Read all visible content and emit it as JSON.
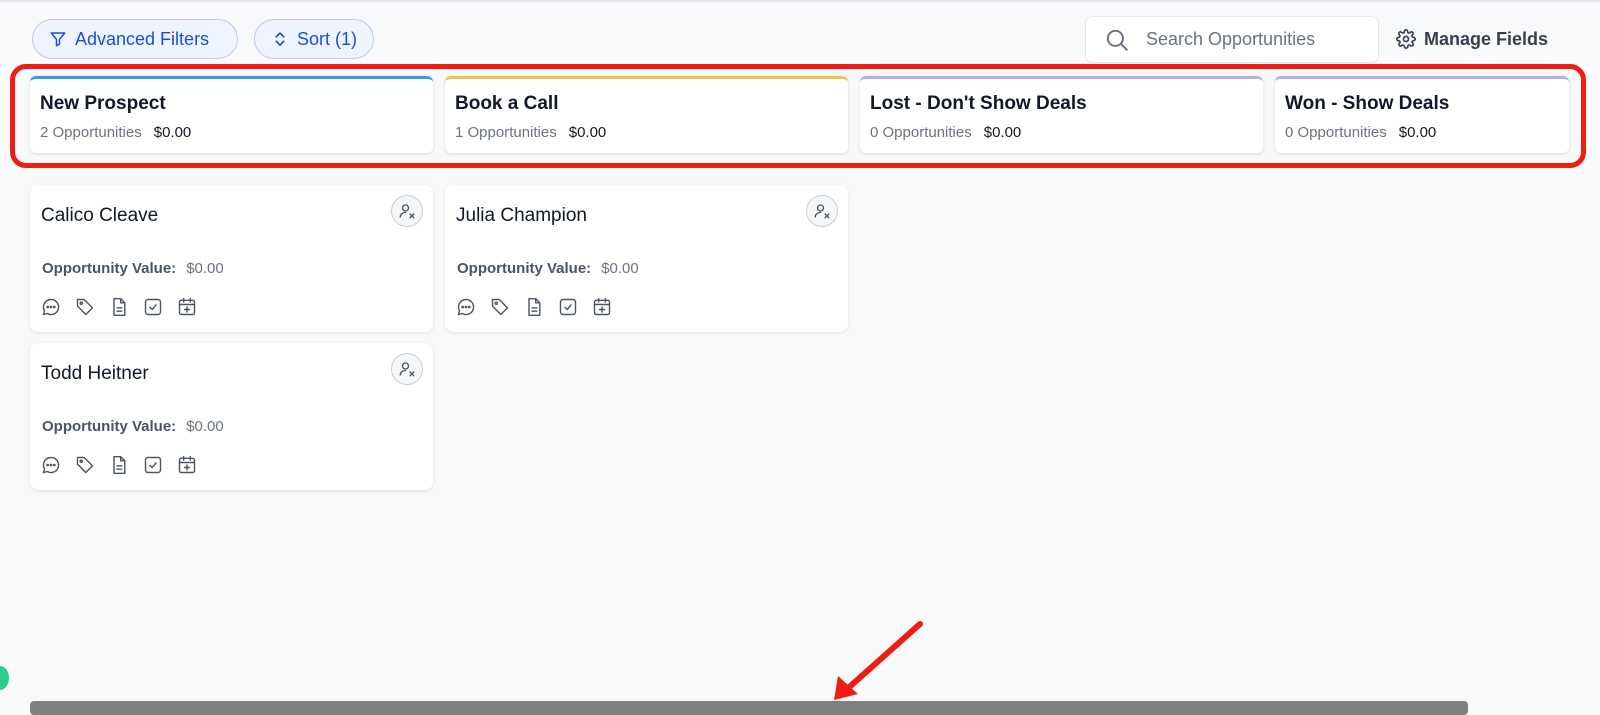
{
  "toolbar": {
    "filters_label": "Advanced Filters",
    "sort_label": "Sort (1)",
    "search_placeholder": "Search Opportunities",
    "manage_fields_label": "Manage Fields",
    "accent_color": "#1d4ed8"
  },
  "stages": [
    {
      "title": "New Prospect",
      "count": "2 Opportunities",
      "value": "$0.00",
      "color": "#3b9be0"
    },
    {
      "title": "Book a Call",
      "count": "1 Opportunities",
      "value": "$0.00",
      "color": "#f2c14b"
    },
    {
      "title": "Lost - Don't Show Deals",
      "count": "0 Opportunities",
      "value": "$0.00",
      "color": "#aab4e6"
    },
    {
      "title": "Won - Show Deals",
      "count": "0 Opportunities",
      "value": "$0.00",
      "color": "#aab4e6"
    }
  ],
  "cards": [
    {
      "name": "Calico Cleave",
      "value_label": "Opportunity Value:",
      "value": "$0.00",
      "stage": "New Prospect"
    },
    {
      "name": "Todd Heitner",
      "value_label": "Opportunity Value:",
      "value": "$0.00",
      "stage": "New Prospect"
    },
    {
      "name": "Julia Champion",
      "value_label": "Opportunity Value:",
      "value": "$0.00",
      "stage": "Book a Call"
    }
  ],
  "card_action_icons": [
    "chat-icon",
    "tag-icon",
    "note-icon",
    "task-icon",
    "calendar-add-icon"
  ],
  "annotation": {
    "highlight_color": "#ee1c12",
    "arrow_color": "#ee1c12"
  }
}
